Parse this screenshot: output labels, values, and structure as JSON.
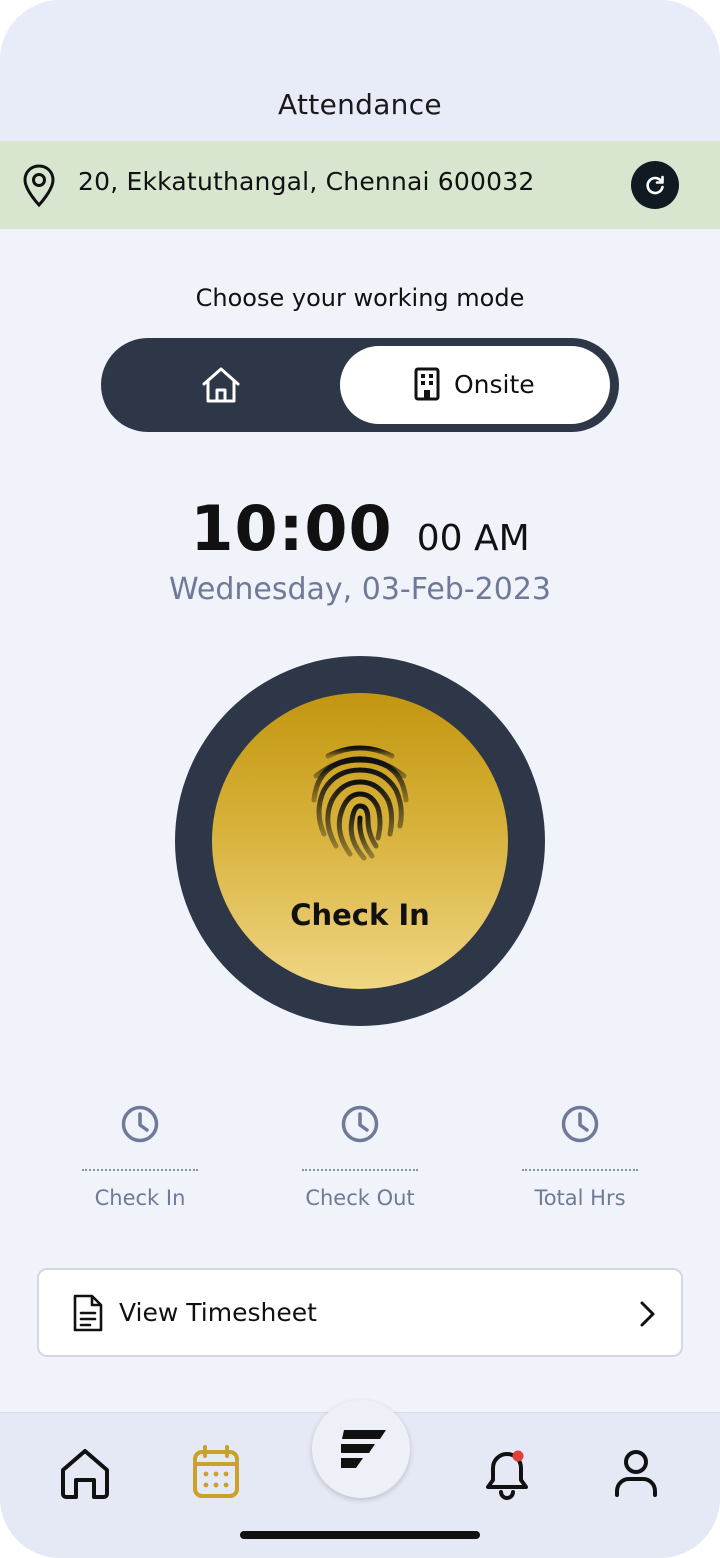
{
  "header": {
    "title": "Attendance"
  },
  "location": {
    "address": "20, Ekkatuthangal, Chennai 600032"
  },
  "working_mode": {
    "prompt": "Choose your working mode",
    "options": [
      "home",
      "Onsite"
    ],
    "selected": "Onsite"
  },
  "clock": {
    "time": "10:00",
    "seconds_ampm": "00 AM",
    "date": "Wednesday, 03-Feb-2023"
  },
  "action": {
    "label": "Check In"
  },
  "stats": [
    {
      "label": "Check In"
    },
    {
      "label": "Check Out"
    },
    {
      "label": "Total Hrs"
    }
  ],
  "timesheet": {
    "label": "View Timesheet"
  },
  "colors": {
    "accent_gold": "#c9a227",
    "dark_navy": "#2e3747",
    "location_bar": "#d8e6d0",
    "muted_text": "#6f7a98",
    "notification_dot": "#e0403a"
  },
  "nav": {
    "items": [
      "home-icon",
      "calendar-icon",
      "brand-logo-icon",
      "bell-icon",
      "profile-icon"
    ],
    "active": "calendar-icon"
  }
}
